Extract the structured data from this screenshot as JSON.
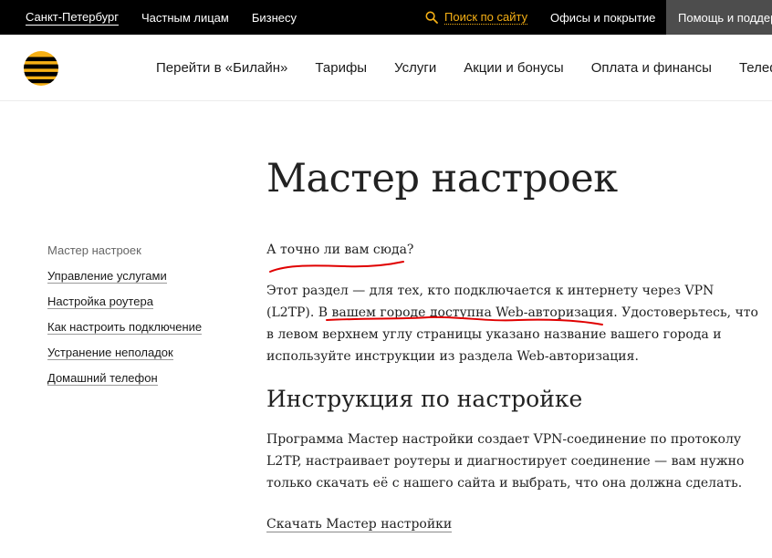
{
  "topbar": {
    "city": "Санкт-Петербург",
    "private": "Частным лицам",
    "business": "Бизнесу",
    "search": "Поиск по сайту",
    "offices": "Офисы и покрытие",
    "help": "Помощь и поддержка"
  },
  "nav": {
    "items": [
      "Перейти в «Билайн»",
      "Тарифы",
      "Услуги",
      "Акции и бонусы",
      "Оплата и финансы",
      "Телефоны"
    ]
  },
  "sidebar": {
    "items": [
      "Мастер настроек",
      "Управление услугами",
      "Настройка роутера",
      "Как настроить подключение",
      "Устранение неполадок",
      "Домашний телефон"
    ]
  },
  "main": {
    "title": "Мастер настроек",
    "question": "А точно ли вам сюда?",
    "para1": {
      "l1": "Этот раздел — для тех, кто подключается к интернету через VPN",
      "l2": "(L2TP). В вашем городе доступна Web-авторизация. Удостоверьтесь, что",
      "l3": "в левом верхнем углу страницы указано название вашего города и",
      "l4": "используйте инструкции из раздела Web-авторизация."
    },
    "section_title": "Инструкция по настройке",
    "para2": {
      "l1": "Программа Мастер настройки создает VPN-соединение по протоколу",
      "l2": "L2TP, настраивает роутеры и диагностирует соединение — вам нужно",
      "l3": "только скачать её с нашего сайта и выбрать, что она должна сделать."
    },
    "download": "Скачать Мастер настройки"
  },
  "colors": {
    "brand_yellow": "#f6b015",
    "annotation_red": "#e00000"
  }
}
